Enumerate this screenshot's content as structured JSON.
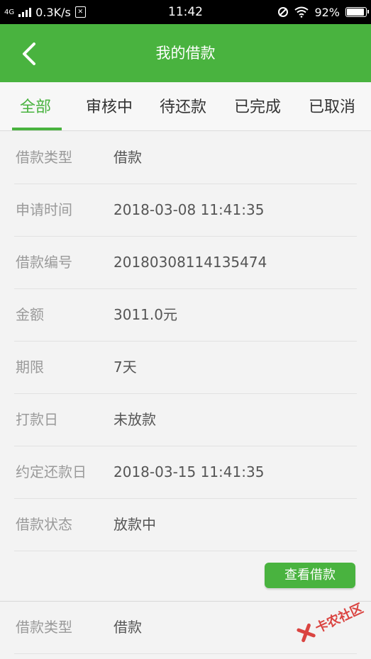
{
  "status_bar": {
    "network": "4G",
    "speed": "0.3K/s",
    "time": "11:42",
    "battery": "92%",
    "battery_level": 0.92
  },
  "header": {
    "title": "我的借款"
  },
  "tabs": [
    {
      "label": "全部",
      "active": true
    },
    {
      "label": "审核中",
      "active": false
    },
    {
      "label": "待还款",
      "active": false
    },
    {
      "label": "已完成",
      "active": false
    },
    {
      "label": "已取消",
      "active": false
    }
  ],
  "loans": [
    {
      "rows": [
        {
          "label": "借款类型",
          "value": "借款"
        },
        {
          "label": "申请时间",
          "value": "2018-03-08 11:41:35"
        },
        {
          "label": "借款编号",
          "value": "20180308114135474"
        },
        {
          "label": "金额",
          "value": "3011.0元"
        },
        {
          "label": "期限",
          "value": "7天"
        },
        {
          "label": "打款日",
          "value": "未放款"
        },
        {
          "label": "约定还款日",
          "value": "2018-03-15 11:41:35"
        },
        {
          "label": "借款状态",
          "value": "放款中"
        }
      ],
      "button": "查看借款"
    },
    {
      "rows": [
        {
          "label": "借款类型",
          "value": "借款"
        }
      ]
    }
  ],
  "watermark": "卡农社区",
  "colors": {
    "accent": "#49b33f",
    "status_bar": "#000000",
    "label": "#9a9a9a",
    "value": "#555555"
  }
}
